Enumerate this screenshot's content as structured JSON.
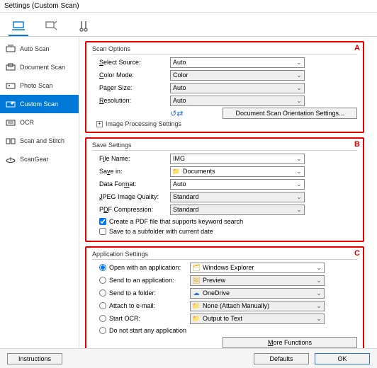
{
  "window": {
    "title": "Settings (Custom Scan)"
  },
  "sidebar": {
    "items": [
      {
        "label": "Auto Scan"
      },
      {
        "label": "Document Scan"
      },
      {
        "label": "Photo Scan"
      },
      {
        "label": "Custom Scan"
      },
      {
        "label": "OCR"
      },
      {
        "label": "Scan and Stitch"
      },
      {
        "label": "ScanGear"
      }
    ]
  },
  "sectionA": {
    "tag": "A",
    "title": "Scan Options",
    "source_label": "Select Source:",
    "source_value": "Auto",
    "color_label": "Color Mode:",
    "color_value": "Color",
    "paper_label": "Paper Size:",
    "paper_value": "Auto",
    "res_label": "Resolution:",
    "res_value": "Auto",
    "orient_button": "Document Scan Orientation Settings...",
    "expander": "Image Processing Settings"
  },
  "sectionB": {
    "tag": "B",
    "title": "Save Settings",
    "filename_label": "File Name:",
    "filename_value": "IMG",
    "savein_label": "Save in:",
    "savein_value": "Documents",
    "format_label": "Data Format:",
    "format_value": "Auto",
    "jpeg_label": "JPEG Image Quality:",
    "jpeg_value": "Standard",
    "pdf_label": "PDF Compression:",
    "pdf_value": "Standard",
    "chk_keyword": "Create a PDF file that supports keyword search",
    "chk_subfolder": "Save to a subfolder with current date"
  },
  "sectionC": {
    "tag": "C",
    "title": "Application Settings",
    "open_label": "Open with an application:",
    "open_value": "Windows Explorer",
    "send_app_label": "Send to an application:",
    "send_app_value": "Preview",
    "send_folder_label": "Send to a folder:",
    "send_folder_value": "OneDrive",
    "email_label": "Attach to e-mail:",
    "email_value": "None (Attach Manually)",
    "ocr_label": "Start OCR:",
    "ocr_value": "Output to Text",
    "none_label": "Do not start any application",
    "more_button": "More Functions"
  },
  "bottom": {
    "instructions": "Instructions",
    "defaults": "Defaults",
    "ok": "OK"
  }
}
